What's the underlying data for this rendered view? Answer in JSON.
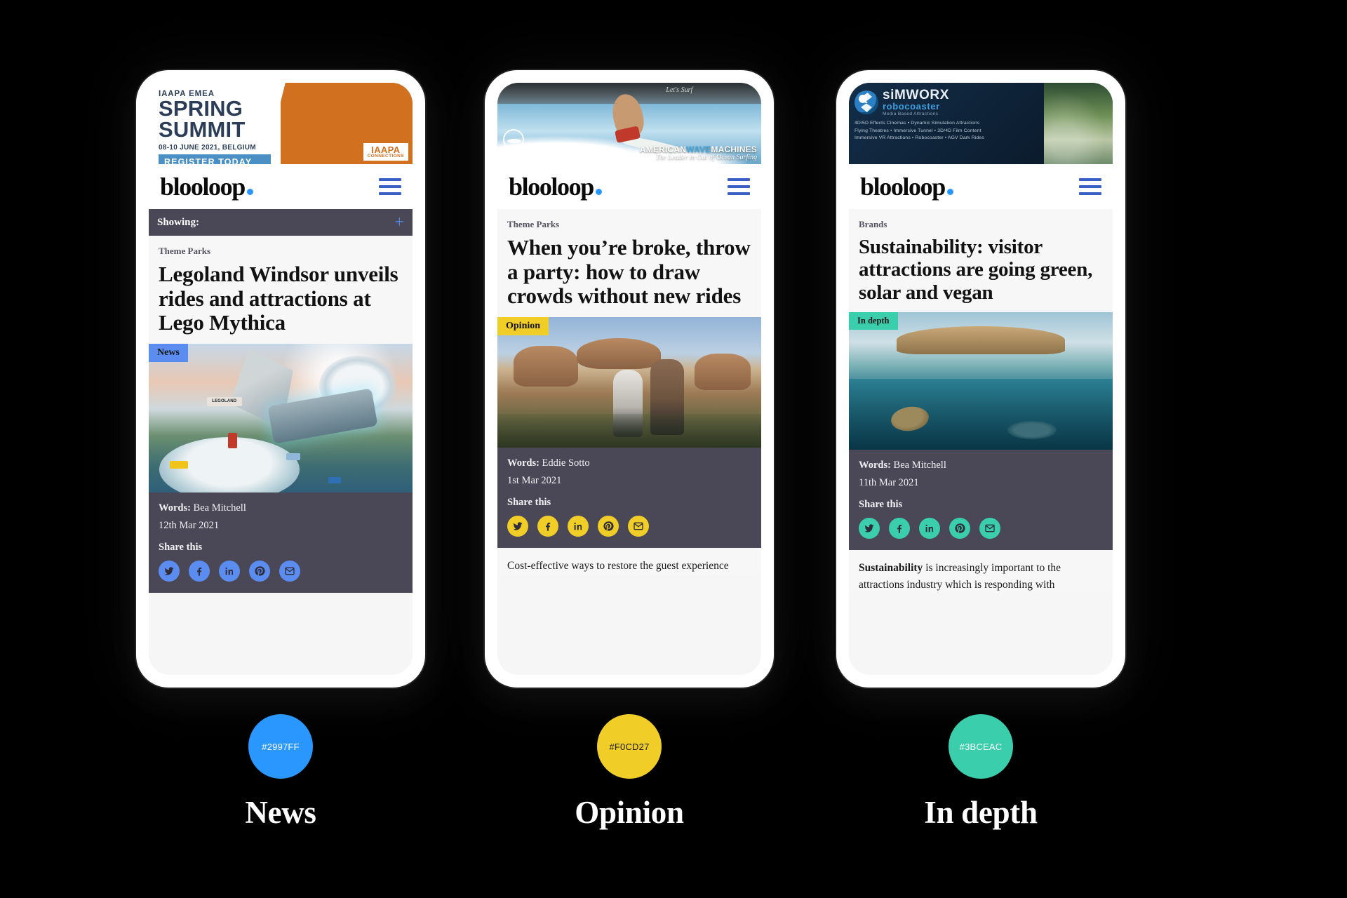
{
  "site": {
    "logo_text": "blooloop",
    "logo_dot_color": "#2997ff"
  },
  "phones": [
    {
      "id": "news",
      "accent": "#2997FF",
      "accent_hex_label": "#2997FF",
      "caption": "News",
      "swatch_text_dark": false,
      "ad": {
        "type": "iaapa-spring-summit",
        "kicker": "IAAPA EMEA",
        "line1": "SPRING",
        "line2": "SUMMIT",
        "date": "08-10 JUNE 2021, BELGIUM",
        "cta": "REGISTER TODAY",
        "logo_main": "IAAPA",
        "logo_sub": "CONNECTIONS"
      },
      "showing_bar": {
        "label": "Showing:",
        "toggle": "+"
      },
      "kicker": "Theme Parks",
      "headline": "Legoland Windsor unveils rides and attractions at Lego Mythica",
      "badge": "News",
      "hero_alt": "lego-mythica-ride-illustration",
      "hero_sign": "LEGOLAND",
      "words_label": "Words:",
      "author": "Bea Mitchell",
      "date": "12th Mar 2021",
      "share_label": "Share this",
      "share": [
        "twitter-icon",
        "facebook-icon",
        "linkedin-icon",
        "pinterest-icon",
        "email-icon"
      ],
      "teaser": ""
    },
    {
      "id": "opinion",
      "accent": "#F0CD27",
      "accent_hex_label": "#F0CD27",
      "caption": "Opinion",
      "swatch_text_dark": true,
      "ad": {
        "type": "american-wave-machines",
        "brand_a": "AMERICAN",
        "brand_b": "WAVE",
        "brand_c": "MACHINES",
        "tagline": "The Leader in Out of Ocean Surfing",
        "overlay_note": "Let's Surf"
      },
      "kicker": "Theme Parks",
      "headline": "When you’re broke, throw a party: how to draw crowds without new rides",
      "badge": "Opinion",
      "hero_alt": "cars-land-guests-photo",
      "words_label": "Words:",
      "author": "Eddie Sotto",
      "date": "1st Mar 2021",
      "share_label": "Share this",
      "share": [
        "twitter-icon",
        "facebook-icon",
        "linkedin-icon",
        "pinterest-icon",
        "email-icon"
      ],
      "teaser": "Cost-effective ways to restore the guest experience"
    },
    {
      "id": "indepth",
      "accent": "#3BCEAC",
      "accent_hex_label": "#3BCEAC",
      "caption": "In depth",
      "swatch_text_dark": false,
      "ad": {
        "type": "simworx-robocoaster",
        "brand_main": "siMWORX",
        "brand_sub": "robocoaster",
        "brand_tag": "Media Based Attractions",
        "features_line1": "4D/5D  Effects  Cinemas  •  Dynamic  Simulation  Attractions",
        "features_line2": "Flying  Theatres  •  Immersive  Tunnel  •  3D/4D  Film  Content",
        "features_line3": "Immersive  VR  Attractions  •  Robocoaster  •  AGV  Dark  Rides"
      },
      "kicker": "Brands",
      "headline": "Sustainability: visitor attractions are going green, solar and vegan",
      "badge": "In depth",
      "hero_alt": "sustainable-attraction-reef-photo",
      "words_label": "Words:",
      "author": "Bea Mitchell",
      "date": "11th Mar 2021",
      "share_label": "Share this",
      "share": [
        "twitter-icon",
        "facebook-icon",
        "linkedin-icon",
        "pinterest-icon",
        "email-icon"
      ],
      "teaser_bold": "Sustainability",
      "teaser": " is increasingly important to the attractions industry which is responding with"
    }
  ]
}
